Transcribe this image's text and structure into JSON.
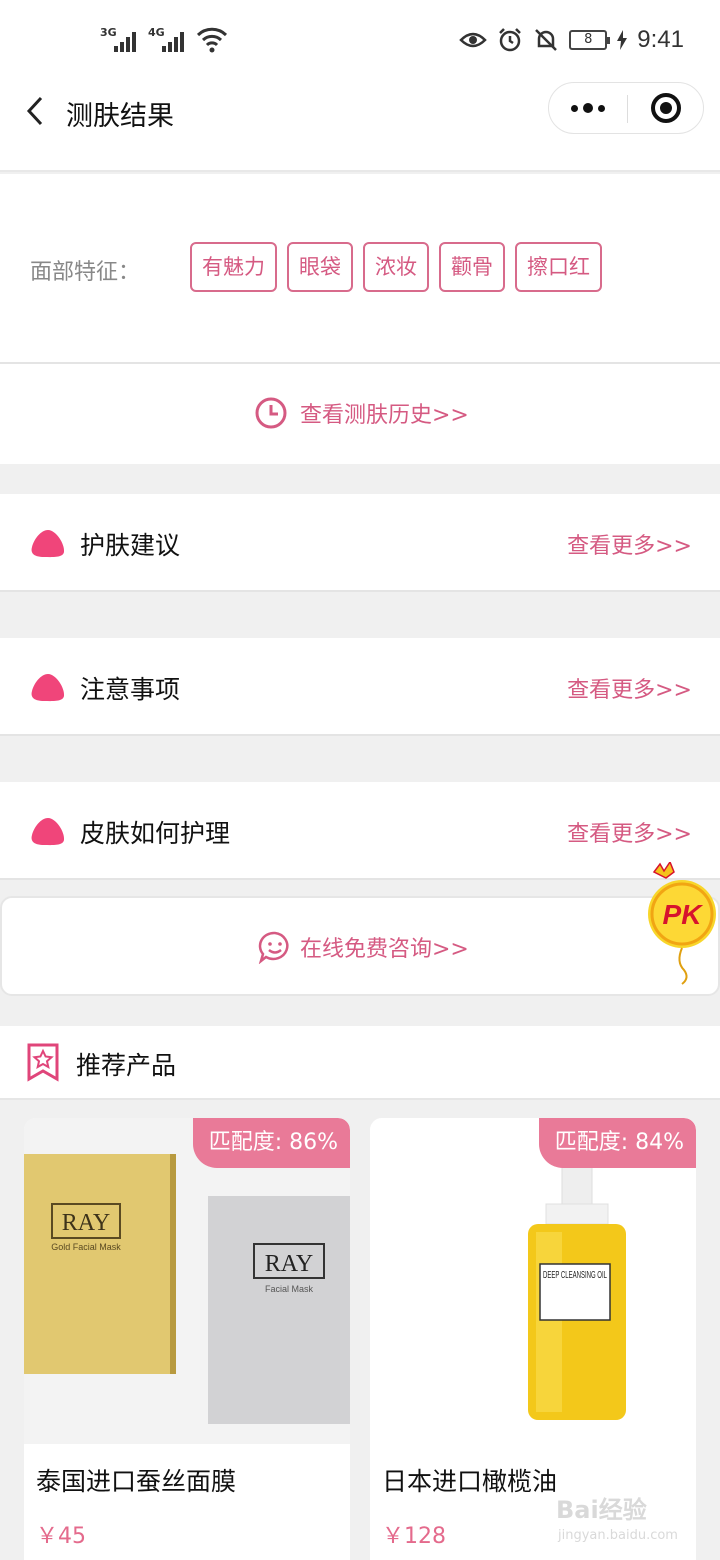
{
  "status": {
    "time": "9:41",
    "battery": "8",
    "net1": "3G",
    "net2": "4G"
  },
  "nav": {
    "title": "测肤结果"
  },
  "features": {
    "label": "面部特征：",
    "tags": [
      "有魅力",
      "眼袋",
      "浓妆",
      "颧骨",
      "擦口红"
    ]
  },
  "history": {
    "label": "查看测肤历史>>"
  },
  "sections": [
    {
      "title": "护肤建议",
      "more": "查看更多>>"
    },
    {
      "title": "注意事项",
      "more": "查看更多>>"
    },
    {
      "title": "皮肤如何护理",
      "more": "查看更多>>"
    }
  ],
  "consult": {
    "label": "在线免费咨询>>"
  },
  "pk": {
    "label": "PK"
  },
  "recommend": {
    "title": "推荐产品",
    "products": [
      {
        "match": "匹配度: 86%",
        "name": "泰国进口蚕丝面膜",
        "price": "￥45",
        "brand": "RAY",
        "sub1": "Gold Facial Mask",
        "sub2": "Facial Mask"
      },
      {
        "match": "匹配度: 84%",
        "name": "日本进口橄榄油",
        "price": "￥128",
        "label": "DEEP CLEANSING OIL"
      }
    ]
  },
  "watermark": {
    "text": "Bai经验",
    "sub": "jingyan.baidu.com"
  },
  "colors": {
    "accent": "#d55a82",
    "blob": "#f0457a",
    "match_bg": "#e97a98"
  }
}
